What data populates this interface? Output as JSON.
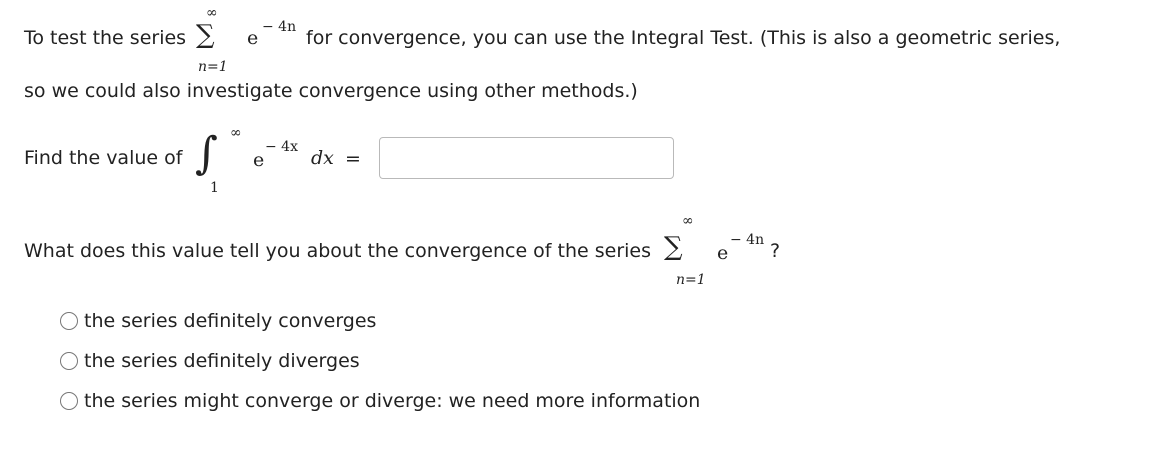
{
  "intro": {
    "prefix": "To test the series",
    "middle": "for convergence, you can use the Integral Test. (This is also a geometric series,",
    "line2": "so we could also investigate convergence using other methods.)"
  },
  "series_expr": {
    "sum_symbol": "∑",
    "upper": "∞",
    "lower": "n=1",
    "base": "e",
    "exponent": "− 4n"
  },
  "integral_prompt": {
    "label": "Find the value of",
    "int_symbol": "∫",
    "upper": "∞",
    "lower": "1",
    "base": "e",
    "exponent": "− 4x",
    "differential": "dx",
    "equals": "=",
    "answer_value": ""
  },
  "question": {
    "text": "What does this value tell you about the convergence of the series",
    "trailing": "?"
  },
  "options": [
    {
      "label": "the series definitely converges"
    },
    {
      "label": "the series definitely diverges"
    },
    {
      "label": "the series might converge or diverge: we need more information"
    }
  ]
}
